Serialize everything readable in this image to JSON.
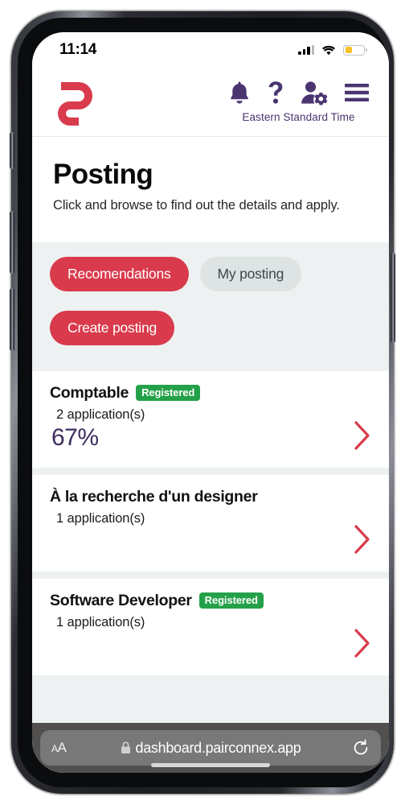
{
  "status_bar": {
    "time": "11:14",
    "signal_icon": "cellular-signal-icon",
    "wifi_icon": "wifi-icon",
    "battery_icon": "battery-low-icon",
    "battery_color": "#f7c325"
  },
  "app_header": {
    "logo_name": "pairconnex-logo",
    "logo_color": "#d93b4c",
    "icons": [
      {
        "name": "notifications-bell-icon",
        "label": "Notifications"
      },
      {
        "name": "help-question-icon",
        "label": "Help"
      },
      {
        "name": "user-settings-icon",
        "label": "Account settings"
      },
      {
        "name": "hamburger-menu-icon",
        "label": "Menu"
      }
    ],
    "icon_color": "#4a3571",
    "timezone_label": "Eastern Standard Time"
  },
  "page": {
    "title": "Posting",
    "subtitle": "Click and browse to find out the details and apply."
  },
  "filters": [
    {
      "label": "Recomendations",
      "style": "primary",
      "selected": true
    },
    {
      "label": "My posting",
      "style": "muted",
      "selected": false
    },
    {
      "label": "Create posting",
      "style": "primary",
      "selected": false
    }
  ],
  "theme": {
    "primary_red": "#d93b4c",
    "badge_green": "#24a148",
    "purple": "#3d2c5e",
    "page_bg": "#eef1f1"
  },
  "postings": [
    {
      "title": "Comptable",
      "badge": "Registered",
      "applications": "2 application(s)",
      "match_percent": "67%",
      "chevron_icon": "chevron-right-icon"
    },
    {
      "title": "À la recherche d'un designer",
      "badge": null,
      "applications": "1 application(s)",
      "match_percent": null,
      "chevron_icon": "chevron-right-icon"
    },
    {
      "title": "Software Developer",
      "badge": "Registered",
      "applications": "1 application(s)",
      "match_percent": null,
      "chevron_icon": "chevron-right-icon"
    }
  ],
  "browser_bar": {
    "text_size_label": "A",
    "text_size_label_small": "A",
    "lock_icon": "lock-icon",
    "url": "dashboard.pairconnex.app",
    "reload_icon": "reload-icon"
  }
}
